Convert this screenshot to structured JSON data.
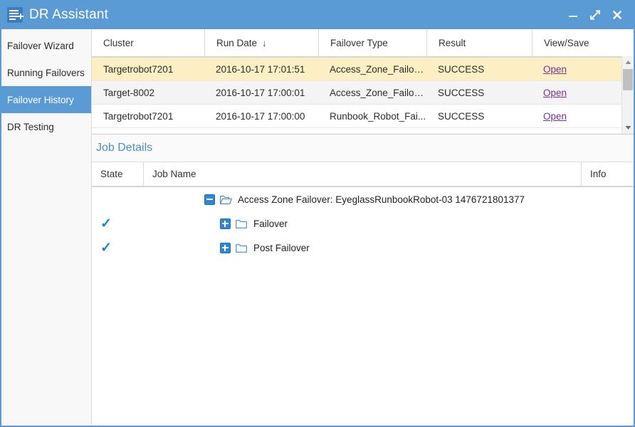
{
  "window": {
    "title": "DR Assistant",
    "app_icon": "list-plus-icon",
    "titlebar_color": "#5b9bd5",
    "buttons": [
      {
        "name": "minimize",
        "glyph": "minimize-icon"
      },
      {
        "name": "maximize",
        "glyph": "maximize-diagonal-icon"
      },
      {
        "name": "close",
        "glyph": "close-icon"
      }
    ]
  },
  "sidebar": {
    "items": [
      {
        "label": "Failover Wizard",
        "active": false
      },
      {
        "label": "Running Failovers",
        "active": false
      },
      {
        "label": "Failover History",
        "active": true
      },
      {
        "label": "DR Testing",
        "active": false
      }
    ],
    "active_color": "#5b9bd5"
  },
  "history_grid": {
    "columns": [
      {
        "label": "Cluster",
        "sort": ""
      },
      {
        "label": "Run Date",
        "sort": "↓"
      },
      {
        "label": "Failover Type",
        "sort": ""
      },
      {
        "label": "Result",
        "sort": ""
      },
      {
        "label": "View/Save",
        "sort": ""
      }
    ],
    "rows": [
      {
        "cluster": "Targetrobot7201",
        "run_date": "2016-10-17 17:01:51",
        "failover_type": "Access_Zone_Failover",
        "result": "SUCCESS",
        "view_save": "Open",
        "selected": true
      },
      {
        "cluster": "Target-8002",
        "run_date": "2016-10-17 17:00:01",
        "failover_type": "Access_Zone_Failover",
        "result": "SUCCESS",
        "view_save": "Open",
        "selected": false
      },
      {
        "cluster": "Targetrobot7201",
        "run_date": "2016-10-17 17:00:00",
        "failover_type": "Runbook_Robot_Fai...",
        "result": "SUCCESS",
        "view_save": "Open",
        "selected": false
      }
    ],
    "selected_row_color": "#fcefc4",
    "link_color": "#7b2f8e"
  },
  "job_details": {
    "title": "Job Details",
    "title_color": "#4a90c4",
    "columns": [
      {
        "label": "State"
      },
      {
        "label": "Job Name"
      },
      {
        "label": "Info"
      }
    ],
    "tree": [
      {
        "state": "",
        "expander": "collapse-minus-icon",
        "folder": "folder-open-icon",
        "label": "Access Zone Failover: EyeglassRunbookRobot-03 1476721801377",
        "depth": 0
      },
      {
        "state": "✓",
        "expander": "expand-plus-icon",
        "folder": "folder-closed-icon",
        "label": "Failover",
        "depth": 1
      },
      {
        "state": "✓",
        "expander": "expand-plus-icon",
        "folder": "folder-closed-icon",
        "label": "Post Failover",
        "depth": 1
      }
    ],
    "check_color": "#1b82d3"
  },
  "scrollbar": {
    "up_arrow": "scroll-up-icon",
    "down_arrow": "scroll-down-icon",
    "thumb": "scroll-thumb"
  }
}
